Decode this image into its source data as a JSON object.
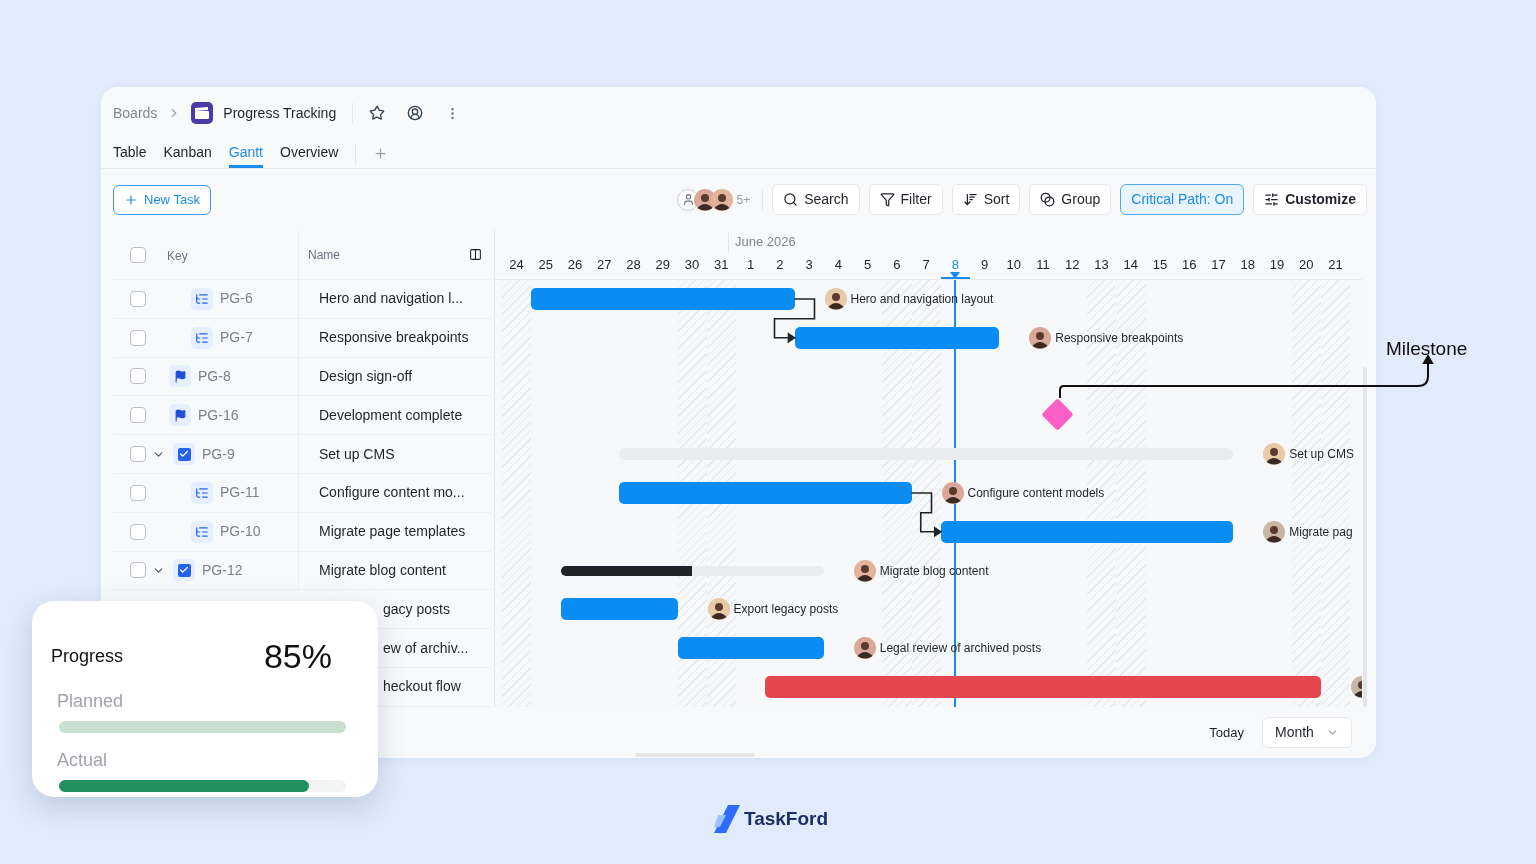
{
  "breadcrumb": {
    "root": "Boards",
    "board": "Progress Tracking"
  },
  "tabs": [
    {
      "label": "Table",
      "selected": false
    },
    {
      "label": "Kanban",
      "selected": false
    },
    {
      "label": "Gantt",
      "selected": true
    },
    {
      "label": "Overview",
      "selected": false
    }
  ],
  "new_task_button": "New Task",
  "toolbar": {
    "members_more": "5+",
    "buttons": [
      {
        "label": "Search",
        "kind": "search",
        "selected": false
      },
      {
        "label": "Filter",
        "kind": "filter",
        "selected": false
      },
      {
        "label": "Sort",
        "kind": "sort",
        "selected": false
      },
      {
        "label": "Group",
        "kind": "group",
        "selected": false
      },
      {
        "label": "Critical Path: On",
        "kind": "plain",
        "selected": true
      },
      {
        "label": "Customize",
        "kind": "customize",
        "selected": false
      }
    ]
  },
  "table": {
    "columns": [
      "Key",
      "Name"
    ],
    "header_checked": false
  },
  "timeline": {
    "month": "June 2026",
    "days": [
      {
        "label": "24",
        "weekend": true,
        "today": false
      },
      {
        "label": "25",
        "weekend": false,
        "today": false
      },
      {
        "label": "26",
        "weekend": false,
        "today": false
      },
      {
        "label": "27",
        "weekend": false,
        "today": false
      },
      {
        "label": "28",
        "weekend": false,
        "today": false
      },
      {
        "label": "29",
        "weekend": false,
        "today": false
      },
      {
        "label": "30",
        "weekend": true,
        "today": false
      },
      {
        "label": "31",
        "weekend": true,
        "today": false
      },
      {
        "label": "1",
        "weekend": false,
        "today": false
      },
      {
        "label": "2",
        "weekend": false,
        "today": false
      },
      {
        "label": "3",
        "weekend": false,
        "today": false
      },
      {
        "label": "4",
        "weekend": false,
        "today": false
      },
      {
        "label": "5",
        "weekend": false,
        "today": false
      },
      {
        "label": "6",
        "weekend": true,
        "today": false
      },
      {
        "label": "7",
        "weekend": true,
        "today": false
      },
      {
        "label": "8",
        "weekend": false,
        "today": true
      },
      {
        "label": "9",
        "weekend": false,
        "today": false
      },
      {
        "label": "10",
        "weekend": false,
        "today": false
      },
      {
        "label": "11",
        "weekend": false,
        "today": false
      },
      {
        "label": "12",
        "weekend": false,
        "today": false
      },
      {
        "label": "13",
        "weekend": true,
        "today": false
      },
      {
        "label": "14",
        "weekend": true,
        "today": false
      },
      {
        "label": "15",
        "weekend": false,
        "today": false
      },
      {
        "label": "16",
        "weekend": false,
        "today": false
      },
      {
        "label": "17",
        "weekend": false,
        "today": false
      },
      {
        "label": "18",
        "weekend": false,
        "today": false
      },
      {
        "label": "19",
        "weekend": false,
        "today": false
      },
      {
        "label": "20",
        "weekend": true,
        "today": false
      },
      {
        "label": "21",
        "weekend": true,
        "today": false
      }
    ]
  },
  "tasks": [
    {
      "key": "PG-6",
      "name": "Hero and navigation l...",
      "kind": "subtask",
      "checked": false,
      "bar": {
        "kind": "task",
        "critical": false,
        "dependency": false,
        "label": "Hero and navigation layout"
      }
    },
    {
      "key": "PG-7",
      "name": "Responsive breakpoints",
      "kind": "subtask",
      "checked": false,
      "bar": {
        "kind": "task",
        "critical": false,
        "dependency": true,
        "label": "Responsive breakpoints"
      }
    },
    {
      "key": "PG-8",
      "name": "Design sign-off",
      "kind": "milestone",
      "checked": false
    },
    {
      "key": "PG-16",
      "name": "Development complete",
      "kind": "milestone",
      "checked": false,
      "bar": {
        "kind": "milestone"
      }
    },
    {
      "key": "PG-9",
      "name": "Set up CMS",
      "kind": "task",
      "checked": false,
      "expanded": true,
      "bar": {
        "kind": "summary",
        "label": "Set up CMS"
      },
      "children": [
        {
          "key": "PG-11",
          "name": "Configure content mo...",
          "kind": "subtask",
          "checked": false,
          "bar": {
            "kind": "task",
            "critical": false,
            "dependency": false,
            "label": "Configure content models"
          }
        },
        {
          "key": "PG-10",
          "name": "Migrate page templates",
          "kind": "subtask",
          "checked": false,
          "bar": {
            "kind": "task",
            "critical": false,
            "dependency": true,
            "label": "Migrate pag"
          }
        }
      ]
    },
    {
      "key": "PG-12",
      "name": "Migrate blog content",
      "kind": "task",
      "checked": false,
      "expanded": true,
      "bar": {
        "kind": "progress",
        "level": 0.5,
        "label": "Migrate blog content"
      },
      "children": [
        {
          "name": "gacy posts",
          "kind": "covered",
          "bar": {
            "kind": "task",
            "critical": false,
            "dependency": false,
            "label": "Export legacy posts"
          }
        },
        {
          "name": "ew of archiv...",
          "kind": "covered",
          "bar": {
            "kind": "task",
            "critical": false,
            "dependency": false,
            "label": "Legal review of archived posts"
          }
        }
      ]
    },
    {
      "name": "heckout flow",
      "kind": "covered",
      "bar": {
        "kind": "task",
        "critical": true,
        "dependency": false
      }
    }
  ],
  "footer": {
    "today": "Today",
    "scale": "Month"
  },
  "progress_card": {
    "title": "Progress",
    "value": "85%",
    "meters": [
      {
        "label": "Planned",
        "kind": "planned"
      },
      {
        "label": "Actual",
        "level": 0.87,
        "kind": "actual"
      }
    ]
  },
  "callout": {
    "label": "Milestone"
  },
  "brand": {
    "name": "TaskFord"
  }
}
